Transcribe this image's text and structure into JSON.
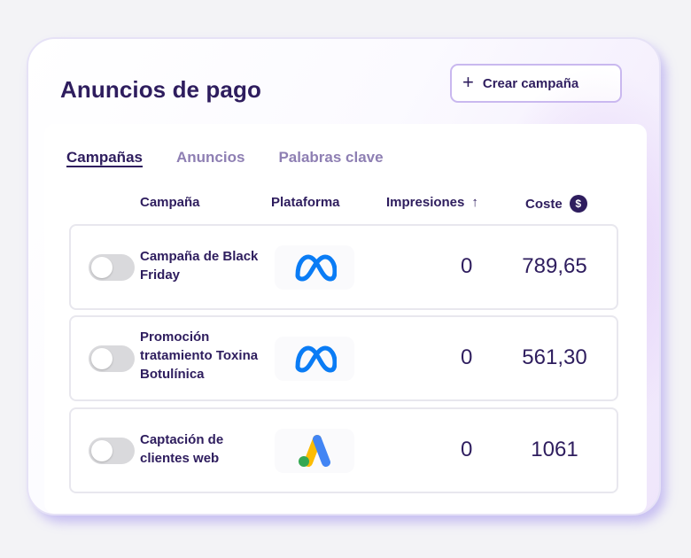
{
  "header": {
    "title": "Anuncios de pago",
    "create_button_label": "Crear campaña",
    "create_icon": "+"
  },
  "tabs": [
    {
      "label": "Campañas",
      "active": true
    },
    {
      "label": "Anuncios",
      "active": false
    },
    {
      "label": "Palabras clave",
      "active": false
    }
  ],
  "table": {
    "columns": {
      "campaign": "Campaña",
      "platform": "Plataforma",
      "impressions": "Impresiones",
      "cost": "Coste"
    },
    "sort_icon": "↑",
    "cost_icon": "$",
    "rows": [
      {
        "name": "Campaña de Black Friday",
        "platform": "meta-logo-icon",
        "impressions": "0",
        "cost": "789,65",
        "enabled": false
      },
      {
        "name": "Promoción tratamiento Toxina Botulínica",
        "platform": "meta-logo-icon",
        "impressions": "0",
        "cost": "561,30",
        "enabled": false
      },
      {
        "name": "Captación de clientes web",
        "platform": "google-ads-logo-icon",
        "impressions": "0",
        "cost": "1061",
        "enabled": false
      }
    ]
  },
  "colors": {
    "primary_text": "#2e1d5e",
    "muted_tab": "#8e7fb3",
    "toggle_off": "#d9d9dc",
    "meta_blue": "#0a7cf5"
  }
}
